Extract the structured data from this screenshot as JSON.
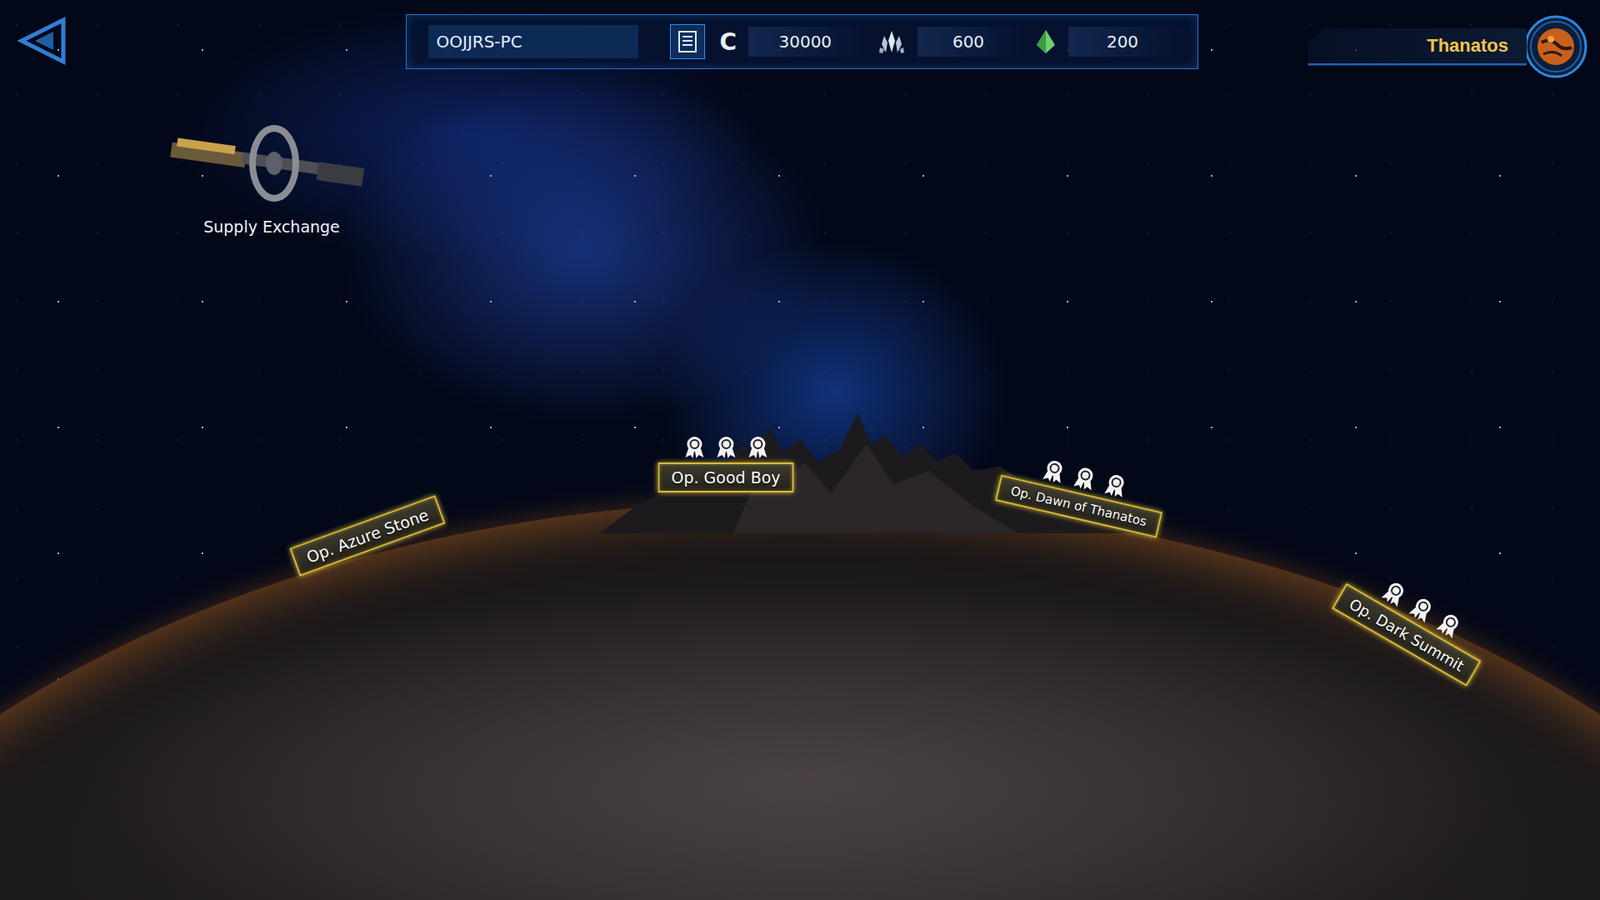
{
  "top_bar": {
    "player": "OOJJRS-PC",
    "currencies": [
      {
        "kind": "credits",
        "symbol": "C",
        "amount": "30000"
      },
      {
        "kind": "crystal",
        "symbol": "",
        "amount": "600"
      },
      {
        "kind": "gem",
        "symbol": "",
        "amount": "200"
      }
    ]
  },
  "planet": {
    "name": "Thanatos"
  },
  "station": {
    "label": "Supply Exchange"
  },
  "operations": [
    {
      "label": "Op. Azure Stone",
      "stars": 0
    },
    {
      "label": "Op. Good Boy",
      "stars": 3
    },
    {
      "label": "Op. Dawn of Thanatos",
      "stars": 3
    },
    {
      "label": "Op. Dark Summit",
      "stars": 3
    }
  ]
}
